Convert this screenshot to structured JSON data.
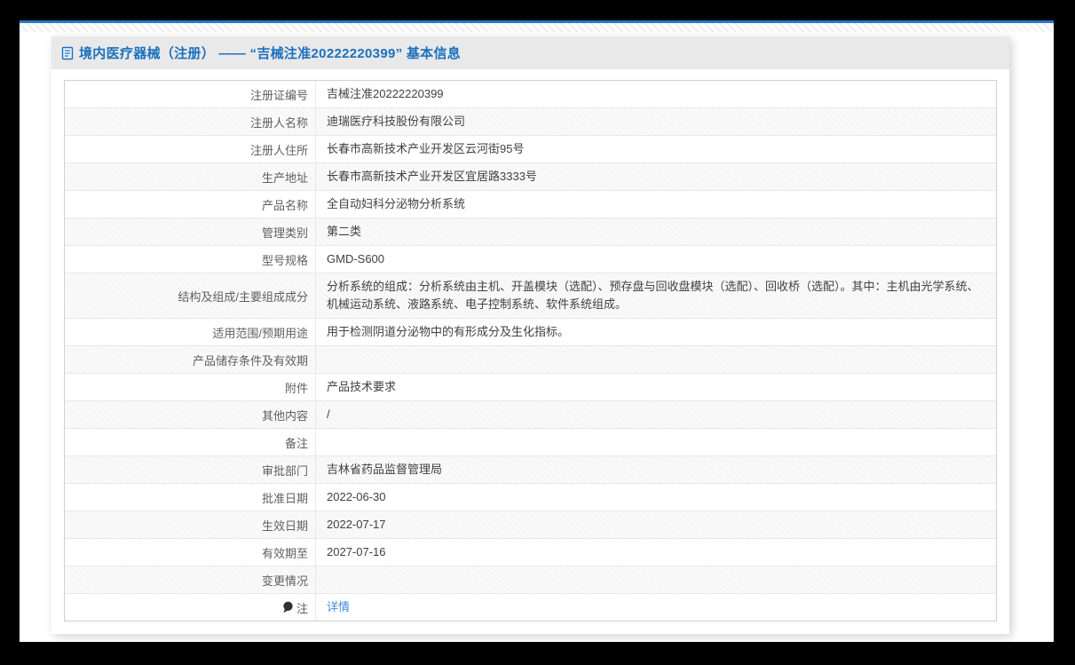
{
  "header": {
    "icon": "document-icon",
    "title": "境内医疗器械（注册） —— “吉械注准20222220399” 基本信息"
  },
  "colors": {
    "frame": "#000000",
    "top_line_blue": "#2878c8",
    "header_bar_bg": "#e9e9e9",
    "title_blue": "#1b70bd",
    "link_blue": "#3e8ddd",
    "label_text": "#5f5f5f",
    "value_text": "#404040",
    "even_row_bg": "#f9f9f9"
  },
  "table": {
    "rows": [
      {
        "label": "注册证编号",
        "value": "吉械注准20222220399"
      },
      {
        "label": "注册人名称",
        "value": "迪瑞医疗科技股份有限公司"
      },
      {
        "label": "注册人住所",
        "value": "长春市高新技术产业开发区云河街95号"
      },
      {
        "label": "生产地址",
        "value": "长春市高新技术产业开发区宜居路3333号"
      },
      {
        "label": "产品名称",
        "value": "全自动妇科分泌物分析系统"
      },
      {
        "label": "管理类别",
        "value": "第二类"
      },
      {
        "label": "型号规格",
        "value": "GMD-S600"
      },
      {
        "label": "结构及组成/主要组成成分",
        "value": "分析系统的组成：分析系统由主机、开盖模块（选配）、预存盘与回收盘模块（选配）、回收桥（选配）。其中：主机由光学系统、机械运动系统、液路系统、电子控制系统、软件系统组成。"
      },
      {
        "label": "适用范围/预期用途",
        "value": "用于检测阴道分泌物中的有形成分及生化指标。"
      },
      {
        "label": "产品储存条件及有效期",
        "value": ""
      },
      {
        "label": "附件",
        "value": "产品技术要求"
      },
      {
        "label": "其他内容",
        "value": "/"
      },
      {
        "label": "备注",
        "value": ""
      },
      {
        "label": "审批部门",
        "value": "吉林省药品监督管理局"
      },
      {
        "label": "批准日期",
        "value": "2022-06-30"
      },
      {
        "label": "生效日期",
        "value": "2022-07-17"
      },
      {
        "label": "有效期至",
        "value": "2027-07-16"
      },
      {
        "label": "变更情况",
        "value": ""
      },
      {
        "label": "注",
        "label_icon": "note-icon",
        "value": "详情",
        "value_is_link": true
      }
    ]
  }
}
